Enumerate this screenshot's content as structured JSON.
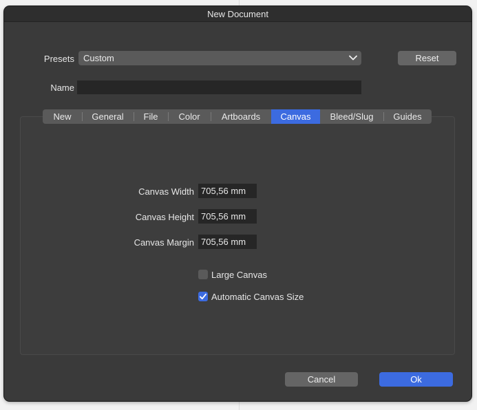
{
  "window": {
    "title": "New Document"
  },
  "presets": {
    "label": "Presets",
    "value": "Custom",
    "icon": "chevron-down-icon"
  },
  "reset": {
    "label": "Reset"
  },
  "name": {
    "label": "Name",
    "value": ""
  },
  "tabs": [
    {
      "label": "New"
    },
    {
      "label": "General"
    },
    {
      "label": "File"
    },
    {
      "label": "Color"
    },
    {
      "label": "Artboards"
    },
    {
      "label": "Canvas",
      "active": true
    },
    {
      "label": "Bleed/Slug"
    },
    {
      "label": "Guides"
    }
  ],
  "canvas": {
    "width": {
      "label": "Canvas Width",
      "value": "705,56 mm"
    },
    "height": {
      "label": "Canvas Height",
      "value": "705,56 mm"
    },
    "margin": {
      "label": "Canvas Margin",
      "value": "705,56 mm"
    },
    "large_canvas": {
      "label": "Large Canvas",
      "checked": false
    },
    "auto_size": {
      "label": "Automatic Canvas Size",
      "checked": true
    }
  },
  "footer": {
    "cancel": "Cancel",
    "ok": "Ok"
  },
  "colors": {
    "accent": "#3c6be0",
    "window_bg": "#3a3a3a",
    "field_bg": "#262626"
  }
}
